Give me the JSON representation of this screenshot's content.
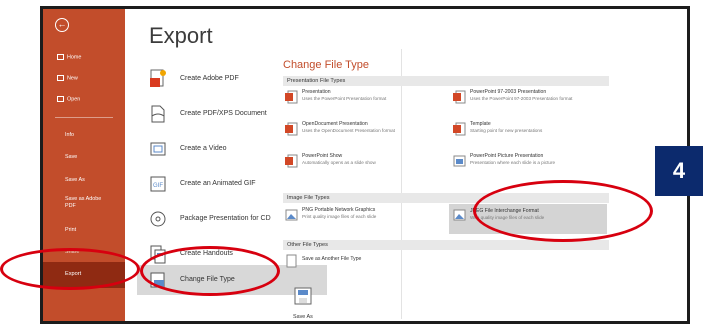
{
  "sidebar": {
    "back_label": "←",
    "items": [
      {
        "label": "Home"
      },
      {
        "label": "New"
      },
      {
        "label": "Open"
      },
      {
        "label": "Info"
      },
      {
        "label": "Save"
      },
      {
        "label": "Save As"
      },
      {
        "label": "Save as Adobe PDF"
      },
      {
        "label": "Print"
      },
      {
        "label": "Share"
      },
      {
        "label": "Export"
      }
    ]
  },
  "main": {
    "title": "Export",
    "options": [
      {
        "label": "Create Adobe PDF",
        "icon": "adobe-pdf-icon"
      },
      {
        "label": "Create PDF/XPS Document",
        "icon": "pdf-xps-document-icon"
      },
      {
        "label": "Create a Video",
        "icon": "video-icon"
      },
      {
        "label": "Create an Animated GIF",
        "icon": "animated-gif-icon"
      },
      {
        "label": "Package Presentation for CD",
        "icon": "cd-package-icon"
      },
      {
        "label": "Create Handouts",
        "icon": "handouts-icon"
      },
      {
        "label": "Change File Type",
        "icon": "change-file-type-icon",
        "selected": true
      }
    ]
  },
  "change_file_type": {
    "title": "Change File Type",
    "sections": {
      "presentation": "Presentation File Types",
      "image": "Image File Types",
      "other": "Other File Types"
    },
    "presentation_types": [
      {
        "name": "Presentation",
        "desc": "Uses the PowerPoint Presentation format"
      },
      {
        "name": "PowerPoint 97-2003 Presentation",
        "desc": "Uses the PowerPoint 97-2003 Presentation format"
      },
      {
        "name": "OpenDocument Presentation",
        "desc": "Uses the OpenDocument Presentation format"
      },
      {
        "name": "Template",
        "desc": "Starting point for new presentations"
      },
      {
        "name": "PowerPoint Show",
        "desc": "Automatically opens as a slide show"
      },
      {
        "name": "PowerPoint Picture Presentation",
        "desc": "Presentation where each slide is a picture"
      }
    ],
    "image_types": [
      {
        "name": "PNG Portable Network Graphics",
        "desc": "Print quality image files of each slide"
      },
      {
        "name": "JPEG File Interchange Format",
        "desc": "Web quality image files of each slide"
      }
    ],
    "other_types": [
      {
        "name": "Save as Another File Type",
        "desc": ""
      }
    ],
    "save_as_label": "Save As"
  },
  "annotation": {
    "step_number": "4",
    "badge_color": "#0c2a6d",
    "circle_color": "#d7000f"
  },
  "colors": {
    "sidebar": "#c24d2b",
    "sidebar_selected": "#8f2a12",
    "accent_title": "#c24d2b"
  }
}
